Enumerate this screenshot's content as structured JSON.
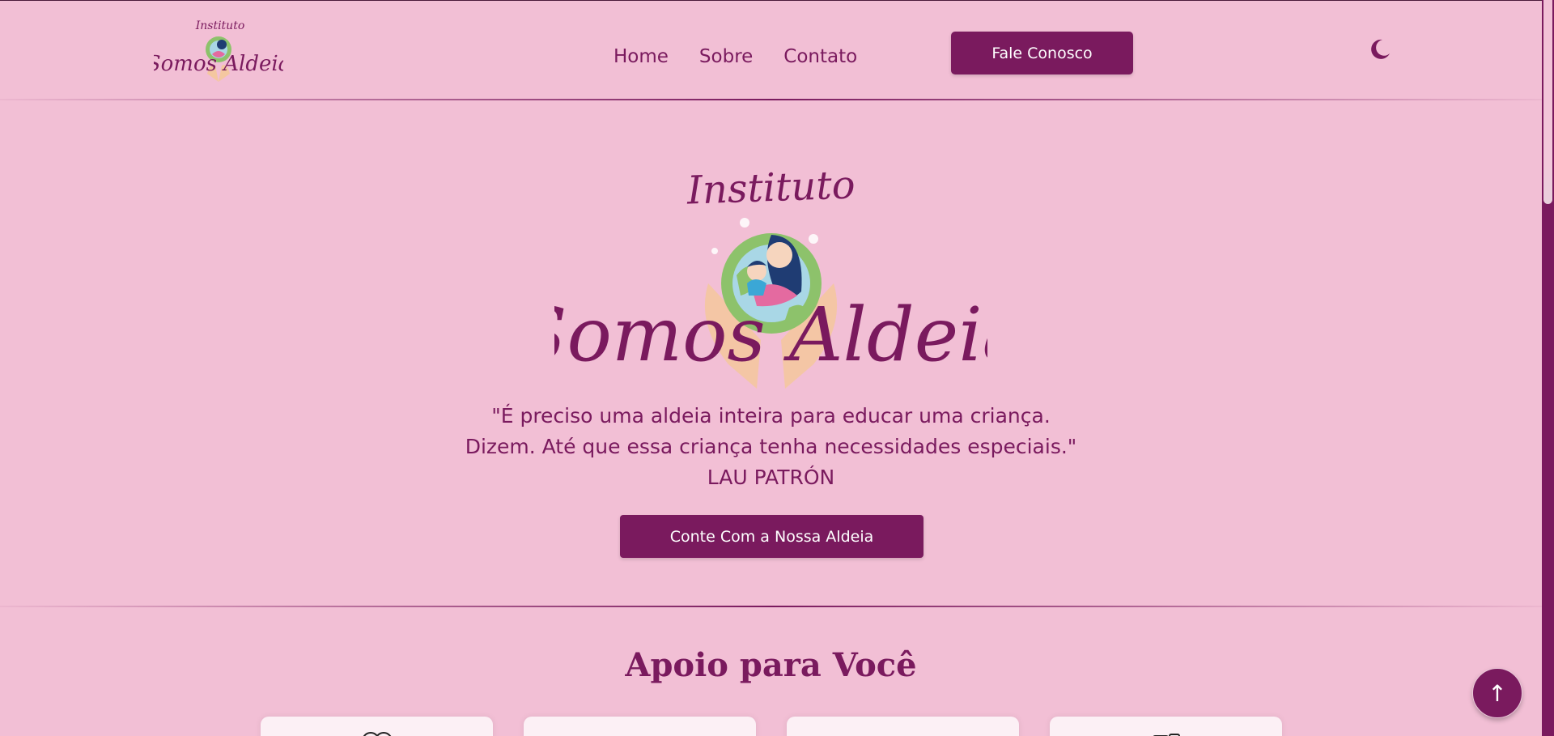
{
  "header": {
    "logo_top": "Instituto",
    "logo_bottom": "Somos Aldeia",
    "nav": [
      "Home",
      "Sobre",
      "Contato"
    ],
    "contact_button": "Fale Conosco",
    "theme_icon": "moon-icon"
  },
  "hero": {
    "logo_top": "Instituto",
    "logo_bottom": "Somos Aldeia",
    "quote_line1": "\"É preciso uma aldeia inteira para educar uma criança.",
    "quote_line2": "Dizem. Até que essa criança tenha necessidades especiais.\"",
    "author": "LAU PATRÓN",
    "cta_button": "Conte Com a Nossa Aldeia"
  },
  "support": {
    "title": "Apoio para Você"
  },
  "fab": {
    "icon": "↑"
  },
  "colors": {
    "background": "#f2bfd5",
    "accent": "#7a1a5e",
    "card": "#fcf0f5"
  }
}
